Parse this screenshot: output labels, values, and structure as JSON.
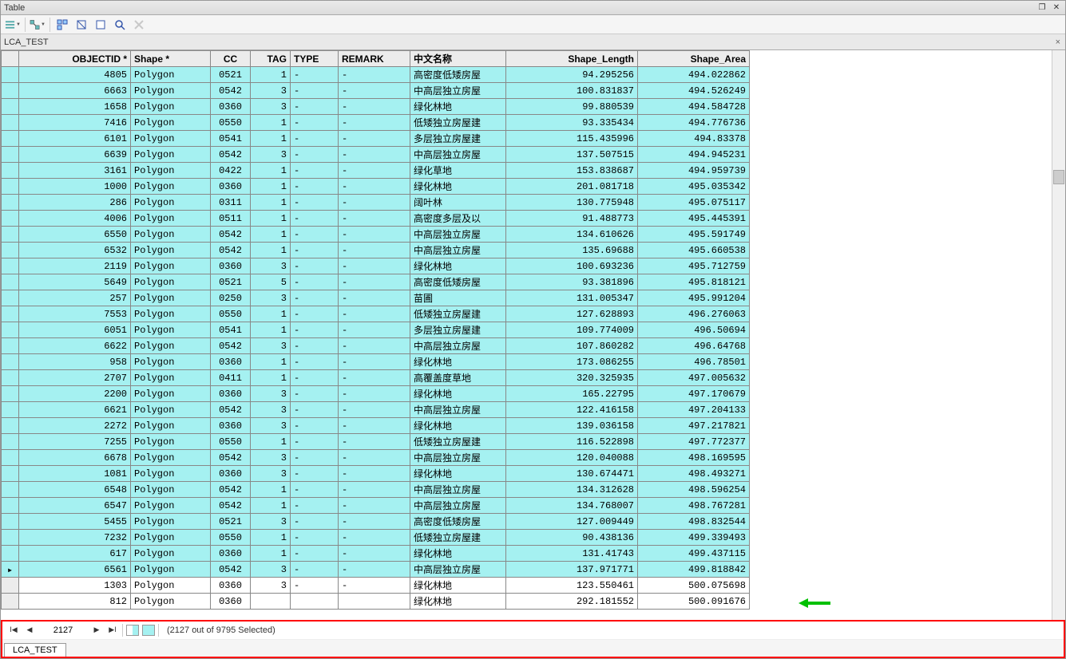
{
  "window": {
    "title": "Table"
  },
  "subtab": "LCA_TEST",
  "columns": [
    "OBJECTID *",
    "Shape *",
    "CC",
    "TAG",
    "TYPE",
    "REMARK",
    "中文名称",
    "Shape_Length",
    "Shape_Area"
  ],
  "rows": [
    {
      "sel": true,
      "objectid": "4805",
      "shape": "Polygon",
      "cc": "0521",
      "tag": "1",
      "type": "-",
      "remark": "-",
      "cn": "高密度低矮房屋",
      "len": "94.295256",
      "area": "494.022862"
    },
    {
      "sel": true,
      "objectid": "6663",
      "shape": "Polygon",
      "cc": "0542",
      "tag": "3",
      "type": "-",
      "remark": "-",
      "cn": "中高层独立房屋",
      "len": "100.831837",
      "area": "494.526249"
    },
    {
      "sel": true,
      "objectid": "1658",
      "shape": "Polygon",
      "cc": "0360",
      "tag": "3",
      "type": "-",
      "remark": "-",
      "cn": "绿化林地",
      "len": "99.880539",
      "area": "494.584728"
    },
    {
      "sel": true,
      "objectid": "7416",
      "shape": "Polygon",
      "cc": "0550",
      "tag": "1",
      "type": "-",
      "remark": "-",
      "cn": "低矮独立房屋建",
      "len": "93.335434",
      "area": "494.776736"
    },
    {
      "sel": true,
      "objectid": "6101",
      "shape": "Polygon",
      "cc": "0541",
      "tag": "1",
      "type": "-",
      "remark": "-",
      "cn": "多层独立房屋建",
      "len": "115.435996",
      "area": "494.83378"
    },
    {
      "sel": true,
      "objectid": "6639",
      "shape": "Polygon",
      "cc": "0542",
      "tag": "3",
      "type": "-",
      "remark": "-",
      "cn": "中高层独立房屋",
      "len": "137.507515",
      "area": "494.945231"
    },
    {
      "sel": true,
      "objectid": "3161",
      "shape": "Polygon",
      "cc": "0422",
      "tag": "1",
      "type": "-",
      "remark": "-",
      "cn": "绿化草地",
      "len": "153.838687",
      "area": "494.959739"
    },
    {
      "sel": true,
      "objectid": "1000",
      "shape": "Polygon",
      "cc": "0360",
      "tag": "1",
      "type": "-",
      "remark": "-",
      "cn": "绿化林地",
      "len": "201.081718",
      "area": "495.035342"
    },
    {
      "sel": true,
      "objectid": "286",
      "shape": "Polygon",
      "cc": "0311",
      "tag": "1",
      "type": "-",
      "remark": "-",
      "cn": "阔叶林",
      "len": "130.775948",
      "area": "495.075117"
    },
    {
      "sel": true,
      "objectid": "4006",
      "shape": "Polygon",
      "cc": "0511",
      "tag": "1",
      "type": "-",
      "remark": "-",
      "cn": "高密度多层及以",
      "len": "91.488773",
      "area": "495.445391"
    },
    {
      "sel": true,
      "objectid": "6550",
      "shape": "Polygon",
      "cc": "0542",
      "tag": "1",
      "type": "-",
      "remark": "-",
      "cn": "中高层独立房屋",
      "len": "134.610626",
      "area": "495.591749"
    },
    {
      "sel": true,
      "objectid": "6532",
      "shape": "Polygon",
      "cc": "0542",
      "tag": "1",
      "type": "-",
      "remark": "-",
      "cn": "中高层独立房屋",
      "len": "135.69688",
      "area": "495.660538"
    },
    {
      "sel": true,
      "objectid": "2119",
      "shape": "Polygon",
      "cc": "0360",
      "tag": "3",
      "type": "-",
      "remark": "-",
      "cn": "绿化林地",
      "len": "100.693236",
      "area": "495.712759"
    },
    {
      "sel": true,
      "objectid": "5649",
      "shape": "Polygon",
      "cc": "0521",
      "tag": "5",
      "type": "-",
      "remark": "-",
      "cn": "高密度低矮房屋",
      "len": "93.381896",
      "area": "495.818121"
    },
    {
      "sel": true,
      "objectid": "257",
      "shape": "Polygon",
      "cc": "0250",
      "tag": "3",
      "type": "-",
      "remark": "-",
      "cn": "苗圃",
      "len": "131.005347",
      "area": "495.991204"
    },
    {
      "sel": true,
      "objectid": "7553",
      "shape": "Polygon",
      "cc": "0550",
      "tag": "1",
      "type": "-",
      "remark": "-",
      "cn": "低矮独立房屋建",
      "len": "127.628893",
      "area": "496.276063"
    },
    {
      "sel": true,
      "objectid": "6051",
      "shape": "Polygon",
      "cc": "0541",
      "tag": "1",
      "type": "-",
      "remark": "-",
      "cn": "多层独立房屋建",
      "len": "109.774009",
      "area": "496.50694"
    },
    {
      "sel": true,
      "objectid": "6622",
      "shape": "Polygon",
      "cc": "0542",
      "tag": "3",
      "type": "-",
      "remark": "-",
      "cn": "中高层独立房屋",
      "len": "107.860282",
      "area": "496.64768"
    },
    {
      "sel": true,
      "objectid": "958",
      "shape": "Polygon",
      "cc": "0360",
      "tag": "1",
      "type": "-",
      "remark": "-",
      "cn": "绿化林地",
      "len": "173.086255",
      "area": "496.78501"
    },
    {
      "sel": true,
      "objectid": "2707",
      "shape": "Polygon",
      "cc": "0411",
      "tag": "1",
      "type": "-",
      "remark": "-",
      "cn": "高覆盖度草地",
      "len": "320.325935",
      "area": "497.005632"
    },
    {
      "sel": true,
      "objectid": "2200",
      "shape": "Polygon",
      "cc": "0360",
      "tag": "3",
      "type": "-",
      "remark": "-",
      "cn": "绿化林地",
      "len": "165.22795",
      "area": "497.170679"
    },
    {
      "sel": true,
      "objectid": "6621",
      "shape": "Polygon",
      "cc": "0542",
      "tag": "3",
      "type": "-",
      "remark": "-",
      "cn": "中高层独立房屋",
      "len": "122.416158",
      "area": "497.204133"
    },
    {
      "sel": true,
      "objectid": "2272",
      "shape": "Polygon",
      "cc": "0360",
      "tag": "3",
      "type": "-",
      "remark": "-",
      "cn": "绿化林地",
      "len": "139.036158",
      "area": "497.217821"
    },
    {
      "sel": true,
      "objectid": "7255",
      "shape": "Polygon",
      "cc": "0550",
      "tag": "1",
      "type": "-",
      "remark": "-",
      "cn": "低矮独立房屋建",
      "len": "116.522898",
      "area": "497.772377"
    },
    {
      "sel": true,
      "objectid": "6678",
      "shape": "Polygon",
      "cc": "0542",
      "tag": "3",
      "type": "-",
      "remark": "-",
      "cn": "中高层独立房屋",
      "len": "120.040088",
      "area": "498.169595"
    },
    {
      "sel": true,
      "objectid": "1081",
      "shape": "Polygon",
      "cc": "0360",
      "tag": "3",
      "type": "-",
      "remark": "-",
      "cn": "绿化林地",
      "len": "130.674471",
      "area": "498.493271"
    },
    {
      "sel": true,
      "objectid": "6548",
      "shape": "Polygon",
      "cc": "0542",
      "tag": "1",
      "type": "-",
      "remark": "-",
      "cn": "中高层独立房屋",
      "len": "134.312628",
      "area": "498.596254"
    },
    {
      "sel": true,
      "objectid": "6547",
      "shape": "Polygon",
      "cc": "0542",
      "tag": "1",
      "type": "-",
      "remark": "-",
      "cn": "中高层独立房屋",
      "len": "134.768007",
      "area": "498.767281"
    },
    {
      "sel": true,
      "objectid": "5455",
      "shape": "Polygon",
      "cc": "0521",
      "tag": "3",
      "type": "-",
      "remark": "-",
      "cn": "高密度低矮房屋",
      "len": "127.009449",
      "area": "498.832544"
    },
    {
      "sel": true,
      "objectid": "7232",
      "shape": "Polygon",
      "cc": "0550",
      "tag": "1",
      "type": "-",
      "remark": "-",
      "cn": "低矮独立房屋建",
      "len": "90.438136",
      "area": "499.339493"
    },
    {
      "sel": true,
      "objectid": "617",
      "shape": "Polygon",
      "cc": "0360",
      "tag": "1",
      "type": "-",
      "remark": "-",
      "cn": "绿化林地",
      "len": "131.41743",
      "area": "499.437115"
    },
    {
      "sel": true,
      "active": true,
      "objectid": "6561",
      "shape": "Polygon",
      "cc": "0542",
      "tag": "3",
      "type": "-",
      "remark": "-",
      "cn": "中高层独立房屋",
      "len": "137.971771",
      "area": "499.818842"
    },
    {
      "sel": false,
      "objectid": "1303",
      "shape": "Polygon",
      "cc": "0360",
      "tag": "3",
      "type": "-",
      "remark": "-",
      "cn": "绿化林地",
      "len": "123.550461",
      "area": "500.075698"
    },
    {
      "sel": false,
      "objectid": "812",
      "shape": "Polygon",
      "cc": "0360",
      "tag": "",
      "type": "",
      "remark": "",
      "cn": "绿化林地",
      "len": "292.181552",
      "area": "500.091676"
    }
  ],
  "nav": {
    "current": "2127",
    "status": "(2127 out of 9795 Selected)"
  },
  "bottom_tab": "LCA_TEST"
}
